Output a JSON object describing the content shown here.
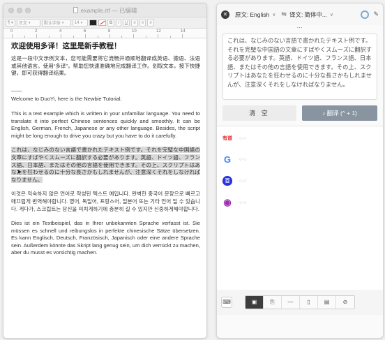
{
  "editor": {
    "title": "example.rtf — 已编辑",
    "toolbar": {
      "style_select": "¶ ▾",
      "style_value": "正文",
      "font_value": "默认字体",
      "size_value": "14",
      "bold": "B",
      "italic": "I",
      "underline": "U"
    },
    "ruler": [
      "0",
      "2",
      "4",
      "6",
      "8",
      "10",
      "12",
      "14"
    ],
    "heading": "欢迎使用多译！这里是新手教程！",
    "p_zh": "这是一段中文示例文本，您可能需要将它流畅并通顺地翻译成英语、德语、法语或其他语言。使用“多译”，帮助您快速准确地完成翻译工作。划取文本，按下快捷键，即可获得翻译结果。",
    "divider": "——",
    "welcome": "Welcome to DuoYi, here is the Newbie Tutorial.",
    "p_en": "This is a text example which is written in your unfamiliar language. You need to translate it into perfect Chinese sentences quickly and smoothly. It can be English, German, French, Japanese or any other language. Besides, the script might be long enough to drive you crazy but you have to do it carefully.",
    "p_ja": "これは、なじみのない言語で書かれたテキスト例です。それを完璧な中国語の文章にすばやくスムーズに翻訳する必要があります。英語、ドイツ語、フランス語、日本語、またはその他の言語を使用できます。その上、スクリプトはあなたを狂わせるのに十分な長さかもしれませんが、注意深くそれをしなければなりません。",
    "p_ko": "이것은 익숙하지 않은 언어로 작성된 텍스트 예입니다. 완벽한 중국어 문장으로 빠르고 매끄럽게 번역해야합니다. 영어, 독일어, 프랑스어, 일본어 또는 기타 언어 일 수 있습니다. 게다가, 스크립트는 당신을 미치게하기에 충분히 길 수 있지만 신중하게해야합니다.",
    "p_de": "Dies ist ein Textbeispiel, das in Ihrer unbekannten Sprache verfasst ist. Sie müssen es schnell und reibungslos in perfekte chinesische Sätze übersetzen. Es kann Englisch, Deutsch, Französisch, Japanisch oder eine andere Sprache sein. Außerdem könnte das Skript lang genug sein, um dich verrückt zu machen, aber du musst es vorsichtig machen."
  },
  "translator": {
    "source_lang_label": "原文:",
    "source_lang": "English",
    "target_lang_label": "译文:",
    "target_lang": "简体中...",
    "drag_handle": "⋯",
    "source_text": "これは、なじみのない言語で書かれたテキスト例です。それを完璧な中国語の文章にすばやくスムーズに翻訳する必要があります。英語、ドイツ語、フランス語、日本語、またはその他の言語を使用できます。その上、スクリプトはあなたを狂わせるのに十分な長さかもしれませんが、注意深くそれをしなければなりません。",
    "clear_label": "清 空",
    "translate_label": "♪ 翻译 (^ + 1)",
    "engines": [
      {
        "name": "youdao",
        "logo": "有道",
        "color": "#e0242a"
      },
      {
        "name": "google",
        "logo": "G",
        "color": "#4285f4"
      },
      {
        "name": "baidu",
        "logo": "百",
        "color": "#2932e1"
      },
      {
        "name": "other",
        "logo": "◉",
        "color": "#9b2fae"
      }
    ]
  }
}
